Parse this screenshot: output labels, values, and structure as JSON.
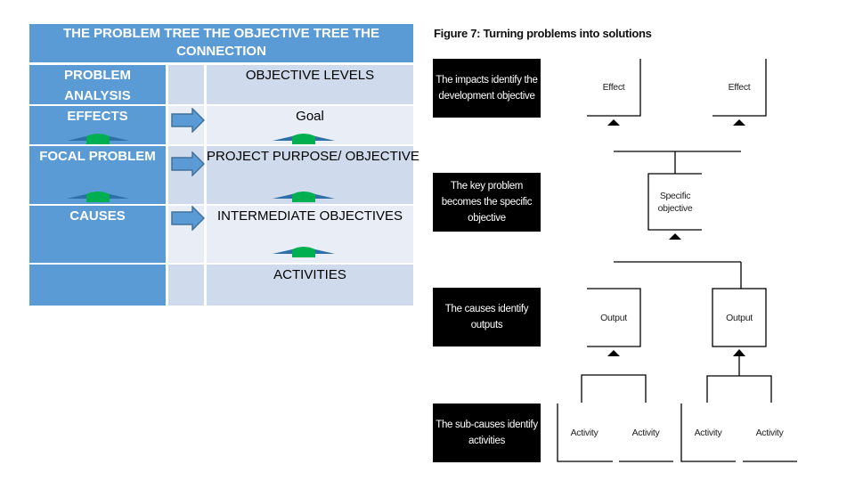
{
  "table": {
    "title": "THE PROBLEM TREE THE OBJECTIVE TREE THE CONNECTION",
    "header_left": "PROBLEM ANALYSIS",
    "header_right": "OBJECTIVE LEVELS",
    "rows": [
      {
        "left": "EFFECTS",
        "right": "Goal"
      },
      {
        "left": "FOCAL  PROBLEM",
        "right": "PROJECT PURPOSE/ OBJECTIVE"
      },
      {
        "left": "CAUSES",
        "right": "INTERMEDIATE OBJECTIVES"
      },
      {
        "left": "",
        "right": "ACTIVITIES"
      }
    ],
    "icons": {
      "right_arrow": "right-arrow-icon",
      "up_arrow": "up-arrow-icon"
    },
    "colors": {
      "header_blue": "#5b9bd5",
      "cell_light": "#cfdbec",
      "cell_lighter": "#e8edf6",
      "arrow_green": "#00b050",
      "arrow_blue": "#4f81bd"
    }
  },
  "figure": {
    "title": "Figure 7: Turning problems into solutions",
    "explanations": [
      "The impacts identify the development objective",
      "The key problem becomes the specific objective",
      "The causes identify outputs",
      "The sub-causes identify activities"
    ],
    "nodes": {
      "effect_1": "Effect",
      "effect_2": "Effect",
      "specific_objective": "Specific objective",
      "output_1": "Output",
      "output_2": "Output",
      "activity_1": "Activity",
      "activity_2": "Activity",
      "activity_3": "Activity",
      "activity_4": "Activity"
    }
  }
}
